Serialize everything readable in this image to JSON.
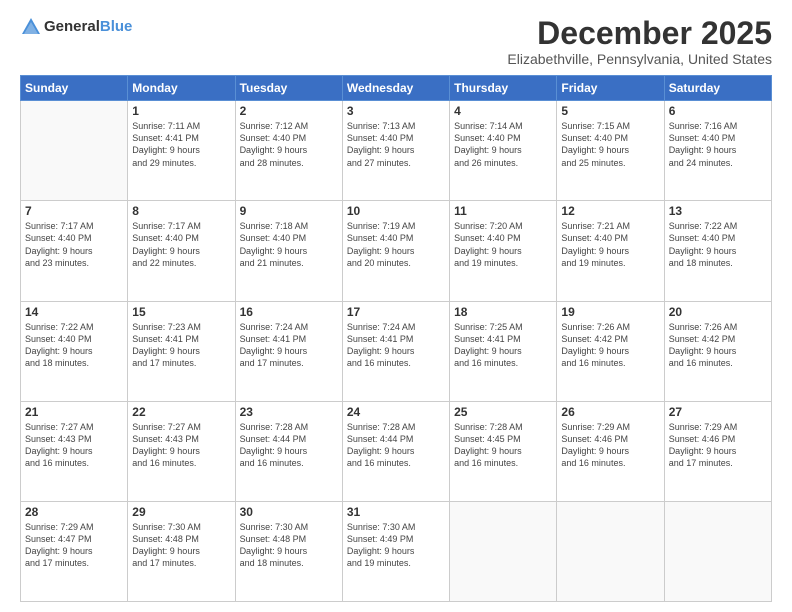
{
  "header": {
    "logo_general": "General",
    "logo_blue": "Blue",
    "month": "December 2025",
    "location": "Elizabethville, Pennsylvania, United States"
  },
  "weekdays": [
    "Sunday",
    "Monday",
    "Tuesday",
    "Wednesday",
    "Thursday",
    "Friday",
    "Saturday"
  ],
  "weeks": [
    [
      {
        "day": "",
        "info": ""
      },
      {
        "day": "1",
        "info": "Sunrise: 7:11 AM\nSunset: 4:41 PM\nDaylight: 9 hours\nand 29 minutes."
      },
      {
        "day": "2",
        "info": "Sunrise: 7:12 AM\nSunset: 4:40 PM\nDaylight: 9 hours\nand 28 minutes."
      },
      {
        "day": "3",
        "info": "Sunrise: 7:13 AM\nSunset: 4:40 PM\nDaylight: 9 hours\nand 27 minutes."
      },
      {
        "day": "4",
        "info": "Sunrise: 7:14 AM\nSunset: 4:40 PM\nDaylight: 9 hours\nand 26 minutes."
      },
      {
        "day": "5",
        "info": "Sunrise: 7:15 AM\nSunset: 4:40 PM\nDaylight: 9 hours\nand 25 minutes."
      },
      {
        "day": "6",
        "info": "Sunrise: 7:16 AM\nSunset: 4:40 PM\nDaylight: 9 hours\nand 24 minutes."
      }
    ],
    [
      {
        "day": "7",
        "info": "Sunrise: 7:17 AM\nSunset: 4:40 PM\nDaylight: 9 hours\nand 23 minutes."
      },
      {
        "day": "8",
        "info": "Sunrise: 7:17 AM\nSunset: 4:40 PM\nDaylight: 9 hours\nand 22 minutes."
      },
      {
        "day": "9",
        "info": "Sunrise: 7:18 AM\nSunset: 4:40 PM\nDaylight: 9 hours\nand 21 minutes."
      },
      {
        "day": "10",
        "info": "Sunrise: 7:19 AM\nSunset: 4:40 PM\nDaylight: 9 hours\nand 20 minutes."
      },
      {
        "day": "11",
        "info": "Sunrise: 7:20 AM\nSunset: 4:40 PM\nDaylight: 9 hours\nand 19 minutes."
      },
      {
        "day": "12",
        "info": "Sunrise: 7:21 AM\nSunset: 4:40 PM\nDaylight: 9 hours\nand 19 minutes."
      },
      {
        "day": "13",
        "info": "Sunrise: 7:22 AM\nSunset: 4:40 PM\nDaylight: 9 hours\nand 18 minutes."
      }
    ],
    [
      {
        "day": "14",
        "info": "Sunrise: 7:22 AM\nSunset: 4:40 PM\nDaylight: 9 hours\nand 18 minutes."
      },
      {
        "day": "15",
        "info": "Sunrise: 7:23 AM\nSunset: 4:41 PM\nDaylight: 9 hours\nand 17 minutes."
      },
      {
        "day": "16",
        "info": "Sunrise: 7:24 AM\nSunset: 4:41 PM\nDaylight: 9 hours\nand 17 minutes."
      },
      {
        "day": "17",
        "info": "Sunrise: 7:24 AM\nSunset: 4:41 PM\nDaylight: 9 hours\nand 16 minutes."
      },
      {
        "day": "18",
        "info": "Sunrise: 7:25 AM\nSunset: 4:41 PM\nDaylight: 9 hours\nand 16 minutes."
      },
      {
        "day": "19",
        "info": "Sunrise: 7:26 AM\nSunset: 4:42 PM\nDaylight: 9 hours\nand 16 minutes."
      },
      {
        "day": "20",
        "info": "Sunrise: 7:26 AM\nSunset: 4:42 PM\nDaylight: 9 hours\nand 16 minutes."
      }
    ],
    [
      {
        "day": "21",
        "info": "Sunrise: 7:27 AM\nSunset: 4:43 PM\nDaylight: 9 hours\nand 16 minutes."
      },
      {
        "day": "22",
        "info": "Sunrise: 7:27 AM\nSunset: 4:43 PM\nDaylight: 9 hours\nand 16 minutes."
      },
      {
        "day": "23",
        "info": "Sunrise: 7:28 AM\nSunset: 4:44 PM\nDaylight: 9 hours\nand 16 minutes."
      },
      {
        "day": "24",
        "info": "Sunrise: 7:28 AM\nSunset: 4:44 PM\nDaylight: 9 hours\nand 16 minutes."
      },
      {
        "day": "25",
        "info": "Sunrise: 7:28 AM\nSunset: 4:45 PM\nDaylight: 9 hours\nand 16 minutes."
      },
      {
        "day": "26",
        "info": "Sunrise: 7:29 AM\nSunset: 4:46 PM\nDaylight: 9 hours\nand 16 minutes."
      },
      {
        "day": "27",
        "info": "Sunrise: 7:29 AM\nSunset: 4:46 PM\nDaylight: 9 hours\nand 17 minutes."
      }
    ],
    [
      {
        "day": "28",
        "info": "Sunrise: 7:29 AM\nSunset: 4:47 PM\nDaylight: 9 hours\nand 17 minutes."
      },
      {
        "day": "29",
        "info": "Sunrise: 7:30 AM\nSunset: 4:48 PM\nDaylight: 9 hours\nand 17 minutes."
      },
      {
        "day": "30",
        "info": "Sunrise: 7:30 AM\nSunset: 4:48 PM\nDaylight: 9 hours\nand 18 minutes."
      },
      {
        "day": "31",
        "info": "Sunrise: 7:30 AM\nSunset: 4:49 PM\nDaylight: 9 hours\nand 19 minutes."
      },
      {
        "day": "",
        "info": ""
      },
      {
        "day": "",
        "info": ""
      },
      {
        "day": "",
        "info": ""
      }
    ]
  ]
}
